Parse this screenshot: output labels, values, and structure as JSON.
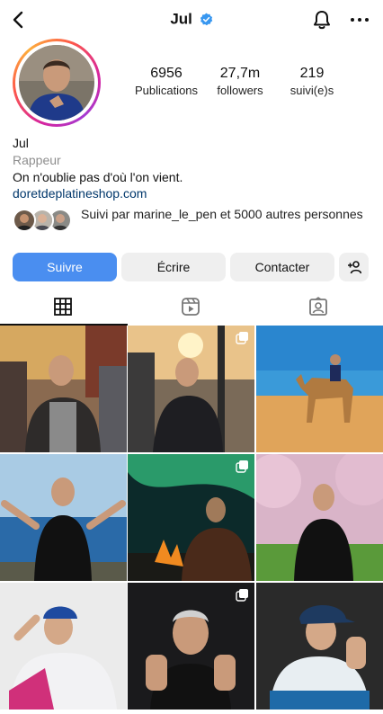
{
  "header": {
    "username": "Jul"
  },
  "profile": {
    "stats": [
      {
        "value": "6956",
        "label": "Publications"
      },
      {
        "value": "27,7m",
        "label": "followers"
      },
      {
        "value": "219",
        "label": "suivi(e)s"
      }
    ],
    "name": "Jul",
    "category": "Rappeur",
    "bio": "On n'oublie pas d'où l'on vient.",
    "link": "doretdeplatineshop.com",
    "followed_by": "Suivi par marine_le_pen et 5000 autres personnes"
  },
  "buttons": {
    "follow": "Suivre",
    "message": "Écrire",
    "contact": "Contacter"
  },
  "colors": {
    "primary_button": "#4a8ef0",
    "secondary_button": "#efefef",
    "link": "#00376b",
    "verified": "#3897f0"
  },
  "icons": [
    "back-icon",
    "verified-icon",
    "bell-icon",
    "more-icon",
    "add-user-icon",
    "grid-icon",
    "reels-icon",
    "tagged-icon",
    "multi-post-icon"
  ]
}
